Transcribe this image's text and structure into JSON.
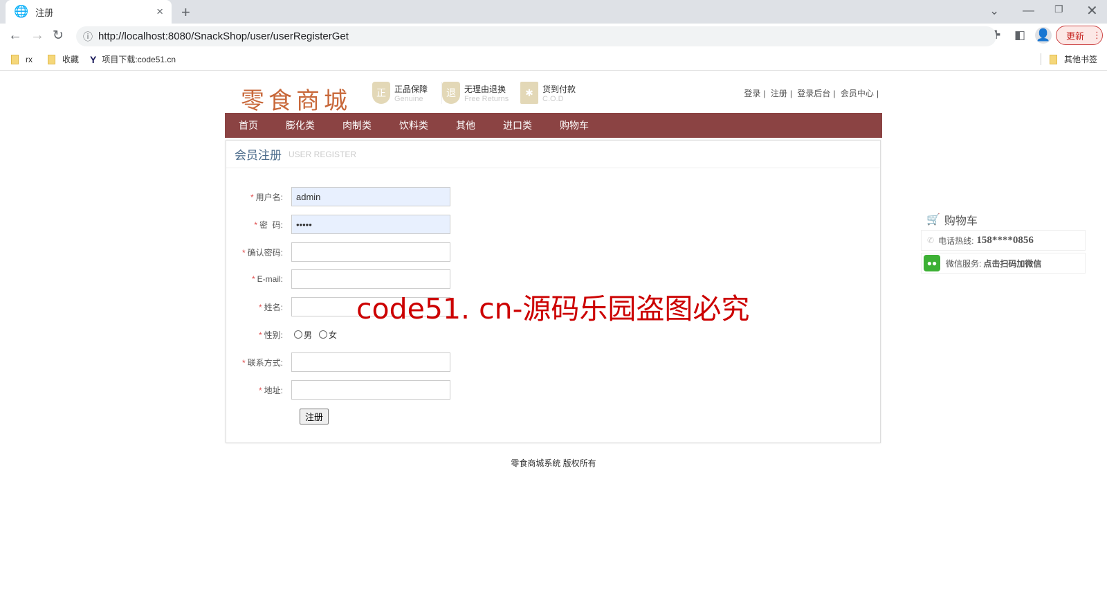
{
  "browser": {
    "tab_title": "注册",
    "url": "http://localhost:8080/SnackShop/user/userRegisterGet",
    "update_label": "更新",
    "bookmarks": [
      "rx",
      "收藏",
      "项目下载:code51.cn"
    ],
    "other_bookmarks": "其他书签"
  },
  "header": {
    "logo": "零食商城",
    "badges": [
      {
        "icon": "正",
        "title": "正品保障",
        "sub": "Genuine"
      },
      {
        "icon": "退",
        "title": "无理由退换",
        "sub": "Free Returns"
      },
      {
        "icon": "✱",
        "title": "货到付款",
        "sub": "C.O.D"
      }
    ],
    "links": [
      "登录",
      "注册",
      "登录后台",
      "会员中心"
    ]
  },
  "nav": [
    "首页",
    "膨化类",
    "肉制类",
    "饮料类",
    "其他",
    "进口类",
    "购物车"
  ],
  "panel": {
    "title": "会员注册",
    "subtitle": "USER REGISTER"
  },
  "form": {
    "required_mark": "*",
    "fields": [
      {
        "label": "用户名:",
        "value": "admin"
      },
      {
        "label": "密  码:",
        "value": "•••••"
      },
      {
        "label": "确认密码:",
        "value": ""
      },
      {
        "label": "E-mail:",
        "value": ""
      },
      {
        "label": "姓名:",
        "value": ""
      },
      {
        "label": "联系方式:",
        "value": ""
      },
      {
        "label": "地址:",
        "value": ""
      }
    ],
    "gender_label": "性别:",
    "gender_options": [
      "男",
      "女"
    ],
    "submit": "注册"
  },
  "side": {
    "cart": "购物车",
    "hotline_label": "电话热线:",
    "hotline": "158****0856",
    "wechat_label": "微信服务:",
    "wechat_text": "点击扫码加微信"
  },
  "watermark": "code51. cn-源码乐园盗图必究",
  "footer": "零食商城系统 版权所有",
  "colors": {
    "nav": "#8b4343",
    "logo": "#c8683a",
    "watermark": "#cc0000",
    "required": "#e05050"
  }
}
